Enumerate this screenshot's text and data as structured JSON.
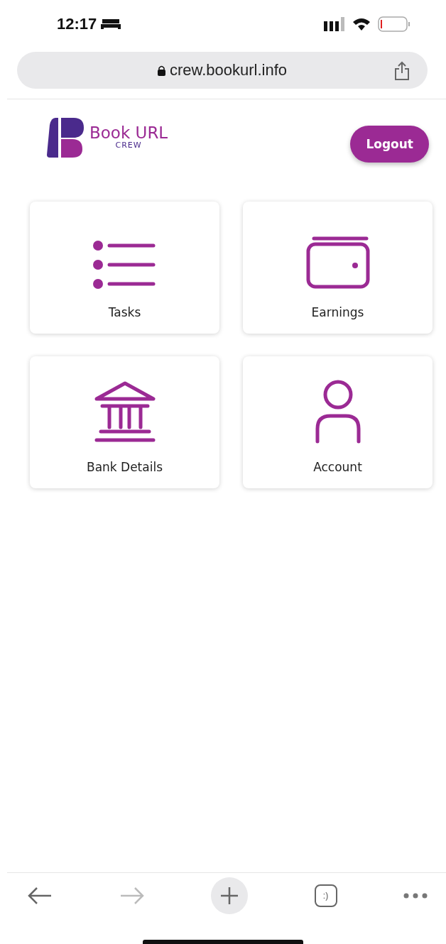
{
  "status_bar": {
    "time": "12:17"
  },
  "address_bar": {
    "url": "crew.bookurl.info"
  },
  "header": {
    "logo": {
      "name": "Book URL",
      "subtitle": "CREW"
    },
    "logout_button": "Logout"
  },
  "tiles": [
    {
      "kind": "list",
      "label": "Tasks"
    },
    {
      "kind": "wallet",
      "label": "Earnings"
    },
    {
      "kind": "bank",
      "label": "Bank Details"
    },
    {
      "kind": "person",
      "label": "Account"
    }
  ],
  "toolbar": {
    "back_disabled": false,
    "forward_disabled": true,
    "tabs_label": ":)"
  }
}
